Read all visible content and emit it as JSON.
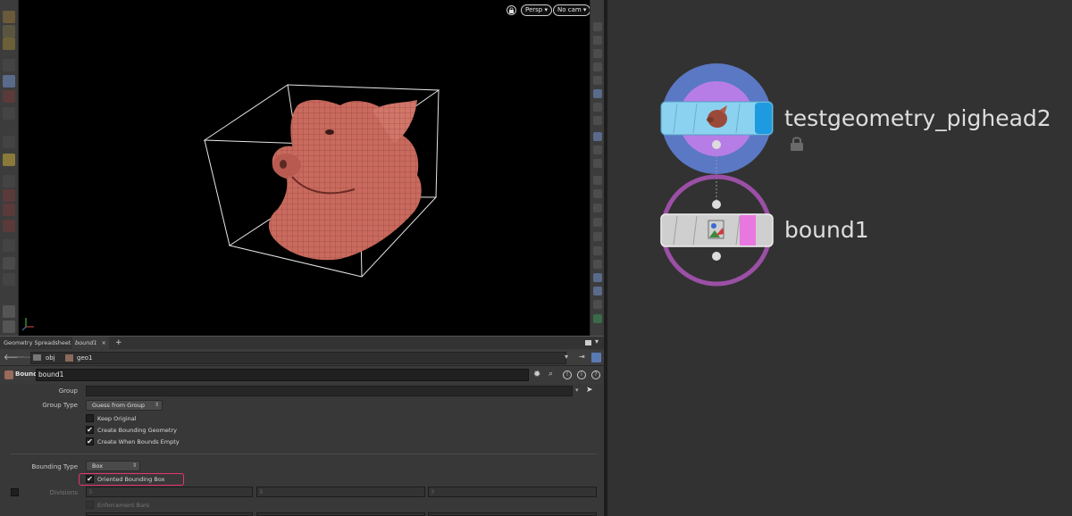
{
  "viewport": {
    "perspective_label": "Persp ▾",
    "camera_label": "No cam ▾"
  },
  "tabs": {
    "spreadsheet_label": "Geometry Spreadsheet",
    "bound_tab_label": "bound1",
    "close_glyph": "×",
    "add_glyph": "+"
  },
  "path": {
    "obj_label": "obj",
    "geo_label": "geo1"
  },
  "sop": {
    "type_label": "Bound",
    "node_name": "bound1"
  },
  "params": {
    "group_label": "Group",
    "group_value": "",
    "group_type_label": "Group Type",
    "group_type_value": "Guess from Group",
    "keep_original_label": "Keep Original",
    "keep_original_checked": false,
    "create_bounding_geometry_label": "Create Bounding Geometry",
    "create_bounding_geometry_checked": true,
    "create_when_empty_label": "Create When Bounds Empty",
    "create_when_empty_checked": true,
    "bounding_type_label": "Bounding Type",
    "bounding_type_value": "Box",
    "oriented_bbox_label": "Oriented Bounding Box",
    "oriented_bbox_checked": true,
    "divisions_label": "Divisions",
    "divisions_values": [
      "3",
      "3",
      "3"
    ],
    "enforcement_bars_label": "Enforcement Bars",
    "check_glyph": "✔",
    "highlight_color": "#e8356a"
  },
  "network": {
    "nodes": [
      {
        "name": "testgeometry_pighead2",
        "locked": true,
        "ring_color": "#5b78c4",
        "inner_color": "#b77de6",
        "bar_color": "#8ad2f0"
      },
      {
        "name": "bound1",
        "locked": false,
        "ring_color": "#9b4fa5",
        "inner_color": "#323232",
        "bar_color": "#cfcfcf"
      }
    ],
    "display_flag_color": "#e877e0",
    "template_flag_color": "#1e9be0"
  }
}
